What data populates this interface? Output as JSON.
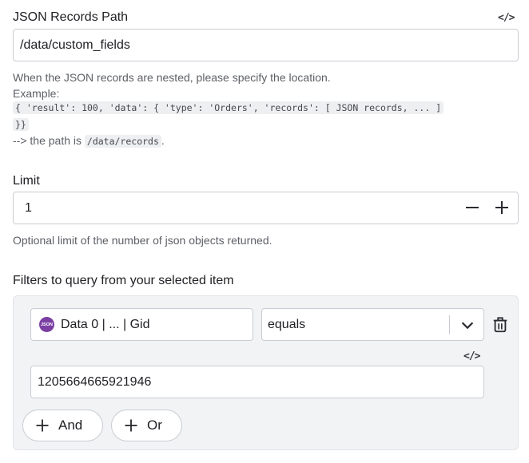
{
  "records_path": {
    "label": "JSON Records Path",
    "value": "/data/custom_fields",
    "hint_line1": "When the JSON records are nested, please specify the location.",
    "hint_example": "Example:",
    "example_code_1": "{ 'result': 100, 'data': { 'type': 'Orders', 'records': [ JSON records, ... ]",
    "example_code_2": "}}",
    "hint_path_prefix": "--> the path is",
    "hint_path_code": "/data/records",
    "hint_path_suffix": "."
  },
  "limit": {
    "label": "Limit",
    "value": "1",
    "hint": "Optional limit of the number of json objects returned."
  },
  "filters": {
    "label": "Filters to query from your selected item",
    "field_badge": "JSON",
    "field_value": "Data 0 | ... | Gid",
    "operator_value": "equals",
    "filter_value": "1205664665921946",
    "and_label": "And",
    "or_label": "Or"
  },
  "code_toggle_glyph": "</>",
  "colors": {
    "badge": "#7b3fa3",
    "panel": "#f2f3f5",
    "border": "#c9ccd2"
  }
}
